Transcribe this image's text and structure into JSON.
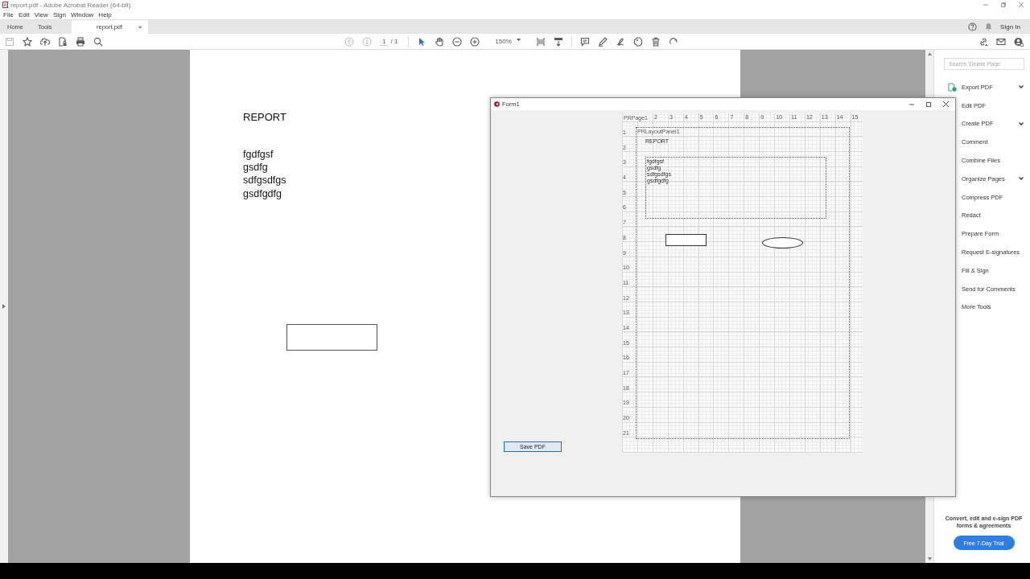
{
  "app_title": "report.pdf - Adobe Acrobat Reader (64-bit)",
  "menu": [
    "File",
    "Edit",
    "View",
    "Sign",
    "Window",
    "Help"
  ],
  "tabs": [
    {
      "label": "Home",
      "selected": false
    },
    {
      "label": "Tools",
      "selected": false
    },
    {
      "label": "report.pdf",
      "selected": true,
      "close": "×"
    }
  ],
  "sign_in": "Sign In",
  "page_nav": {
    "current": "1",
    "total": "/ 1"
  },
  "zoom": "150%",
  "document": {
    "heading": "REPORT",
    "lines": [
      "fgdfgsf",
      "gsdfg",
      "sdfgsdfgs",
      "gsdfgdfg"
    ]
  },
  "tools_panel": {
    "search_placeholder": "Search 'Delete Page'",
    "items": [
      {
        "label": "Export PDF",
        "has_submenu": true
      },
      {
        "label": "Edit PDF",
        "has_submenu": false
      },
      {
        "label": "Create PDF",
        "has_submenu": true
      },
      {
        "label": "Comment",
        "has_submenu": false
      },
      {
        "label": "Combine Files",
        "has_submenu": false
      },
      {
        "label": "Organize Pages",
        "has_submenu": true
      },
      {
        "label": "Compress PDF",
        "has_submenu": false
      },
      {
        "label": "Redact",
        "has_submenu": false
      },
      {
        "label": "Prepare Form",
        "has_submenu": false
      },
      {
        "label": "Request E-signatures",
        "has_submenu": false
      },
      {
        "label": "Fill & Sign",
        "has_submenu": false
      },
      {
        "label": "Send for Comments",
        "has_submenu": false
      },
      {
        "label": "More Tools",
        "has_submenu": false
      }
    ],
    "promo": "Convert, edit and e-sign PDF forms & agreements",
    "trial_button": "Free 7-Day Trial"
  },
  "form_window": {
    "title": "Form1",
    "save_button": "Save PDF",
    "designer": {
      "page_label": "PRPage1",
      "top_ruler": [
        "2",
        "3",
        "4",
        "5",
        "6",
        "7",
        "8",
        "9",
        "10",
        "11",
        "12",
        "13",
        "14",
        "15"
      ],
      "left_ruler": [
        "1",
        "2",
        "3",
        "4",
        "5",
        "6",
        "7",
        "8",
        "9",
        "10",
        "11",
        "12",
        "13",
        "14",
        "15",
        "16",
        "17",
        "18",
        "19",
        "20",
        "21"
      ],
      "panel_label": "PRLayoutPanel1",
      "heading": "REPORT",
      "lines": [
        "fgdfgsf",
        "gsdfg",
        "sdfgsdfgs",
        "gsdfgdfg"
      ]
    }
  }
}
